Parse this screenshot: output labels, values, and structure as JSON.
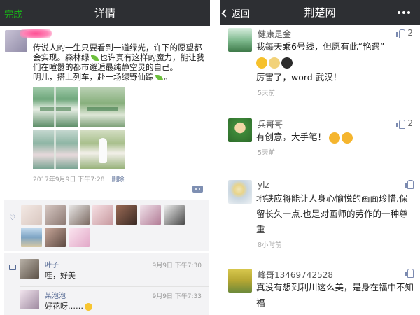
{
  "left": {
    "nav": {
      "done": "完成",
      "title": "详情"
    },
    "post": {
      "lines": [
        "传说人的一生只要看到一道绿光，许下的愿望都会实现。森林绿",
        "也许真有这样的魔力，能让我们在喧嚣的都市邂逅最纯静空灵的自己。",
        "明儿，搭上列车，赴一场绿野仙踪"
      ],
      "time": "2017年9月9日 下午7:28",
      "delete": "删除"
    },
    "comments": [
      {
        "name": "叶子",
        "text": "哇，好美",
        "time": "9月9日 下午7:30"
      },
      {
        "name": "某泡泡",
        "text": "好花呀……",
        "time": "9月9日 下午7:33"
      }
    ]
  },
  "right": {
    "nav": {
      "back": "返回",
      "title": "荆楚网"
    },
    "comments": [
      {
        "name": "健康是金",
        "text": "我每天乘6号线，但愿有此“艳遇”",
        "text2": "厉害了，word 武汉！",
        "time": "5天前",
        "likes": "2"
      },
      {
        "name": "兵哥哥",
        "text": "有创意，大手笔！",
        "time": "5天前",
        "likes": "2"
      },
      {
        "name": "ylz",
        "text": "地铁应将能让人身心愉悦的画面珍惜.保留长久一点.也是对画师的劳作的一种尊重",
        "time": "8小时前",
        "likes": ""
      },
      {
        "name": "峰哥13469742528",
        "text": "真没有想到利川这么美，是身在福中不知福",
        "likes": ""
      }
    ]
  },
  "colors": {
    "nav_bg": "#2d2f33",
    "link": "#576b95",
    "done_green": "#1aad19"
  }
}
